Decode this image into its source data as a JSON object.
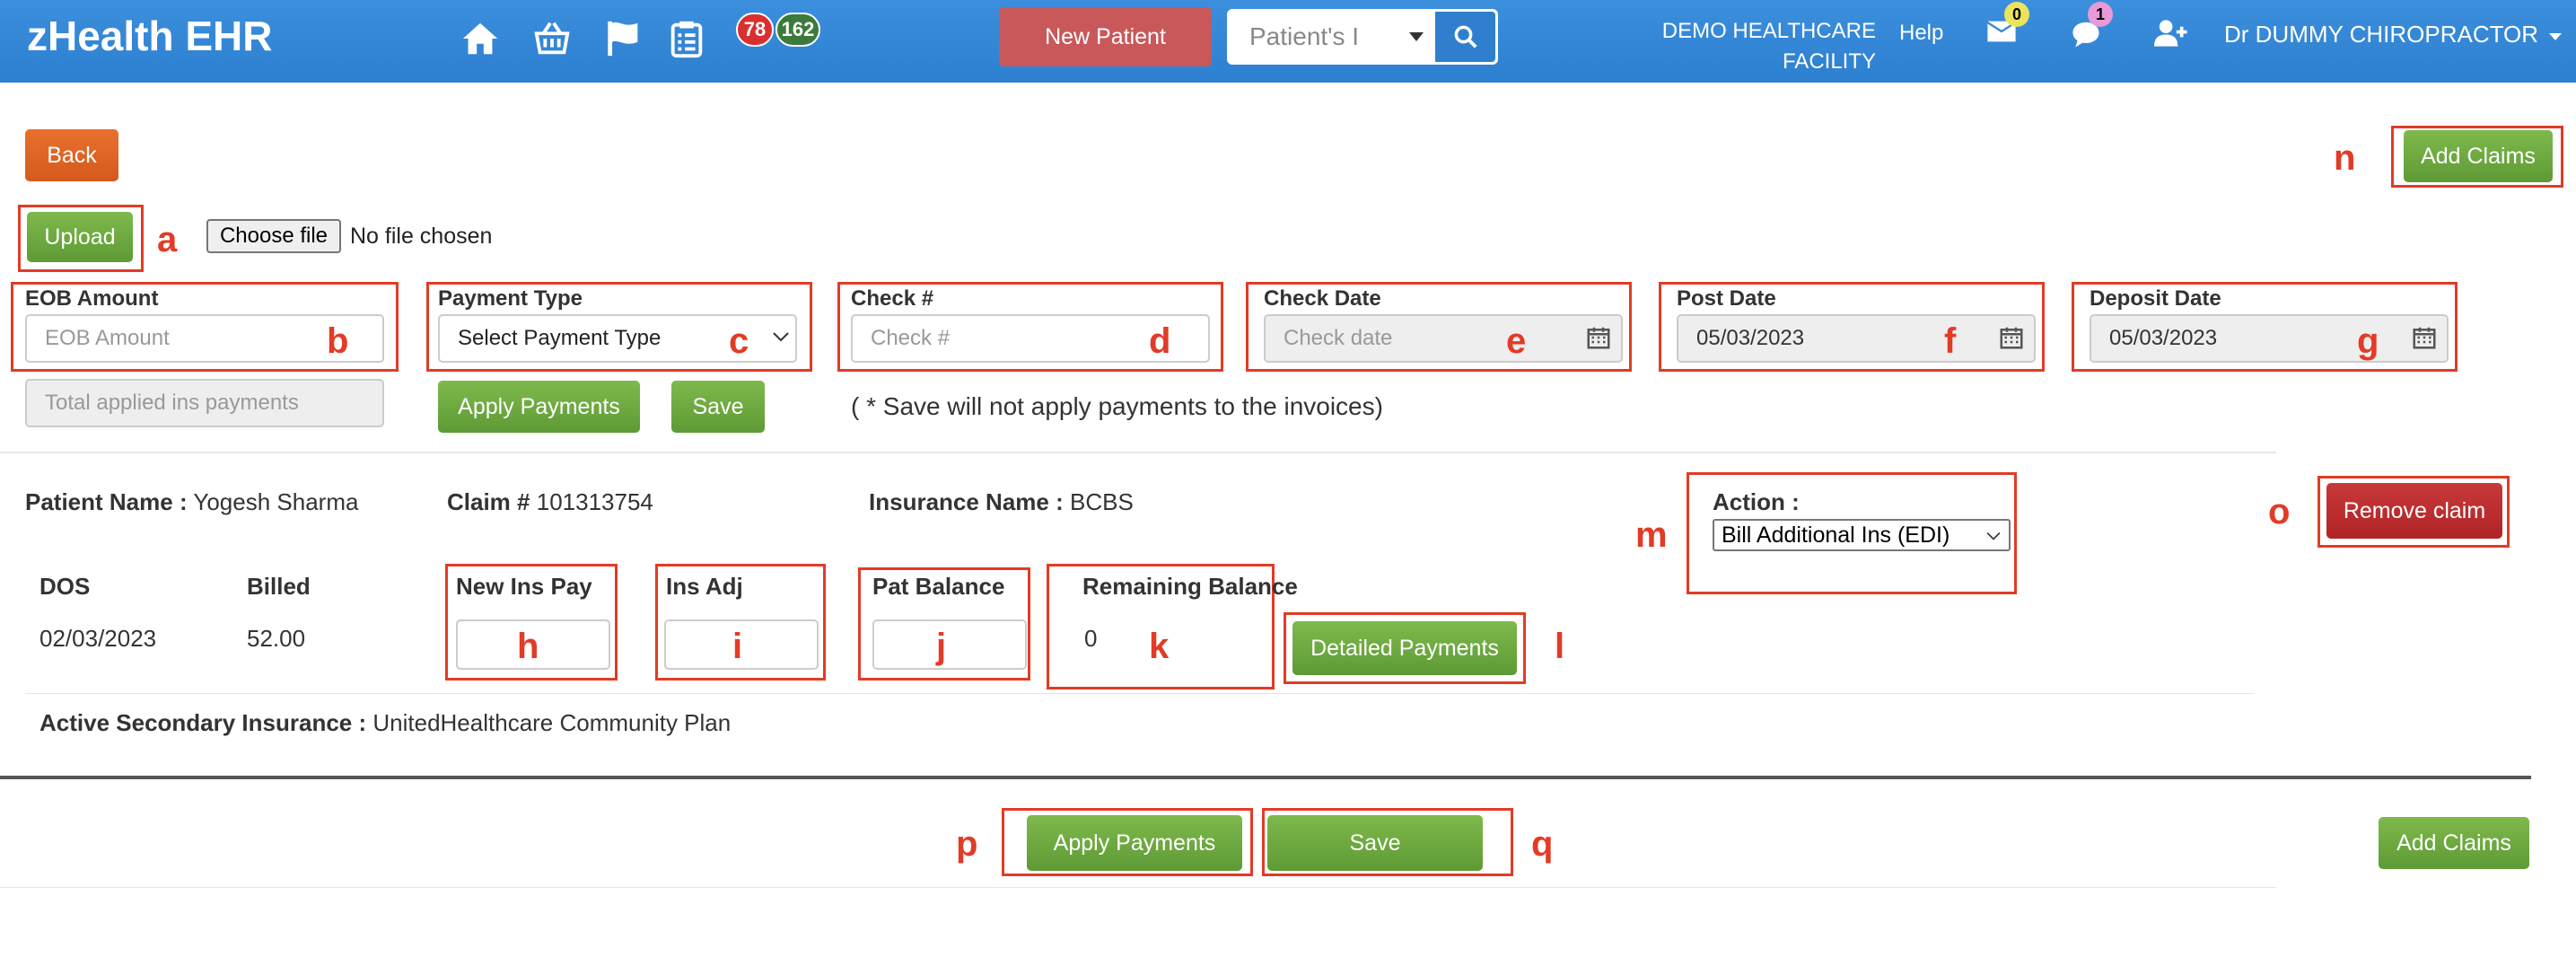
{
  "header": {
    "brand": "zHealth EHR",
    "badge_red": "78",
    "badge_green": "162",
    "new_patient": "New Patient",
    "search_placeholder": "Patient's I",
    "facility_line1": "DEMO HEALTHCARE",
    "facility_line2": "FACILITY",
    "help": "Help",
    "mail_count": "0",
    "chat_count": "1",
    "user": "Dr DUMMY CHIROPRACTOR"
  },
  "toolbar": {
    "back": "Back",
    "add_claims": "Add Claims",
    "upload": "Upload",
    "choose_file": "Choose file",
    "no_file": "No file chosen"
  },
  "form": {
    "eob_label": "EOB Amount",
    "eob_placeholder": "EOB Amount",
    "total_placeholder": "Total applied ins payments",
    "payment_type_label": "Payment Type",
    "payment_type_value": "Select Payment Type",
    "check_label": "Check #",
    "check_placeholder": "Check #",
    "check_date_label": "Check Date",
    "check_date_placeholder": "Check date",
    "post_date_label": "Post Date",
    "post_date_value": "05/03/2023",
    "deposit_date_label": "Deposit Date",
    "deposit_date_value": "05/03/2023",
    "apply_payments": "Apply Payments",
    "save": "Save",
    "save_note": "( * Save will not apply payments to the invoices)"
  },
  "claim": {
    "patient_label": "Patient Name :",
    "patient_value": "Yogesh Sharma",
    "claim_label": "Claim #",
    "claim_value": "101313754",
    "insurance_label": "Insurance Name :",
    "insurance_value": "BCBS",
    "action_label": "Action :",
    "action_value": "Bill Additional Ins (EDI)",
    "remove_claim": "Remove claim",
    "col_dos": "DOS",
    "col_billed": "Billed",
    "col_new_ins_pay": "New Ins Pay",
    "col_ins_adj": "Ins Adj",
    "col_pat_balance": "Pat Balance",
    "col_remaining": "Remaining Balance",
    "dos_value": "02/03/2023",
    "billed_value": "52.00",
    "remaining_value": "0",
    "detailed_payments": "Detailed Payments",
    "secondary_label": "Active Secondary Insurance :",
    "secondary_value": "UnitedHealthcare Community Plan"
  },
  "footer": {
    "apply_payments": "Apply Payments",
    "save": "Save",
    "add_claims": "Add Claims"
  },
  "annotations": {
    "a": "a",
    "b": "b",
    "c": "c",
    "d": "d",
    "e": "e",
    "f": "f",
    "g": "g",
    "h": "h",
    "i": "i",
    "j": "j",
    "k": "k",
    "l": "l",
    "m": "m",
    "n": "n",
    "o": "o",
    "p": "p",
    "q": "q"
  },
  "colors": {
    "header_blue": "#2d7fd0",
    "annotation_red": "#e23b26",
    "button_green": "#6aa83e",
    "button_orange": "#e0642a",
    "button_red": "#b72a2c"
  }
}
